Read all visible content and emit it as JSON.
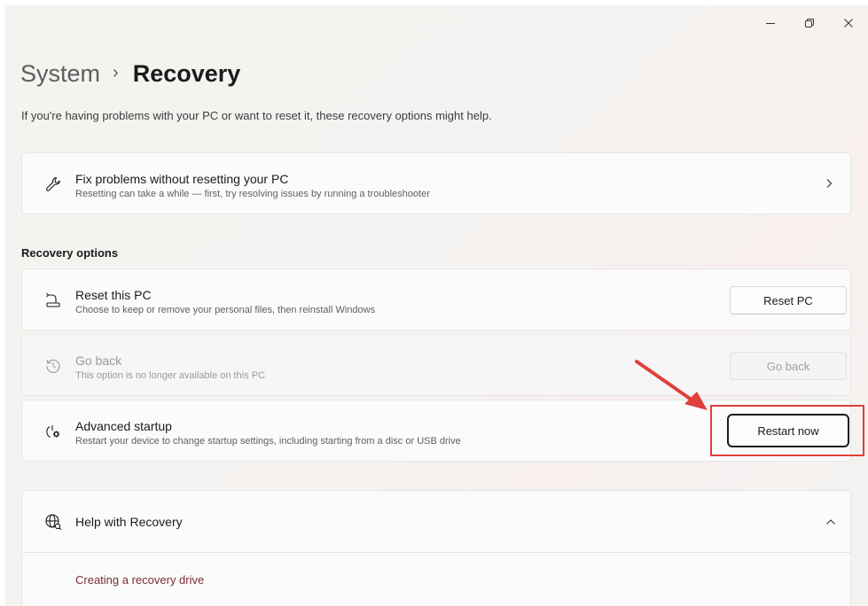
{
  "window": {
    "controls": {
      "minimize": "–",
      "restore": "❐",
      "close": "✕"
    }
  },
  "breadcrumb": {
    "parent": "System",
    "separator": "›",
    "current": "Recovery"
  },
  "subtitle": "If you're having problems with your PC or want to reset it, these recovery options might help.",
  "fix_card": {
    "icon": "wrench-icon",
    "title": "Fix problems without resetting your PC",
    "description": "Resetting can take a while — first, try resolving issues by running a troubleshooter"
  },
  "recovery_options": {
    "label": "Recovery options",
    "items": [
      {
        "icon": "reset-pc-icon",
        "title": "Reset this PC",
        "description": "Choose to keep or remove your personal files, then reinstall Windows",
        "button": "Reset PC",
        "enabled": true
      },
      {
        "icon": "history-icon",
        "title": "Go back",
        "description": "This option is no longer available on this PC",
        "button": "Go back",
        "enabled": false
      },
      {
        "icon": "advanced-startup-icon",
        "title": "Advanced startup",
        "description": "Restart your device to change startup settings, including starting from a disc or USB drive",
        "button": "Restart now",
        "enabled": true
      }
    ]
  },
  "help": {
    "icon": "globe-icon",
    "title": "Help with Recovery",
    "links": [
      "Creating a recovery drive"
    ]
  },
  "annotation": {
    "color": "#e0403a"
  }
}
